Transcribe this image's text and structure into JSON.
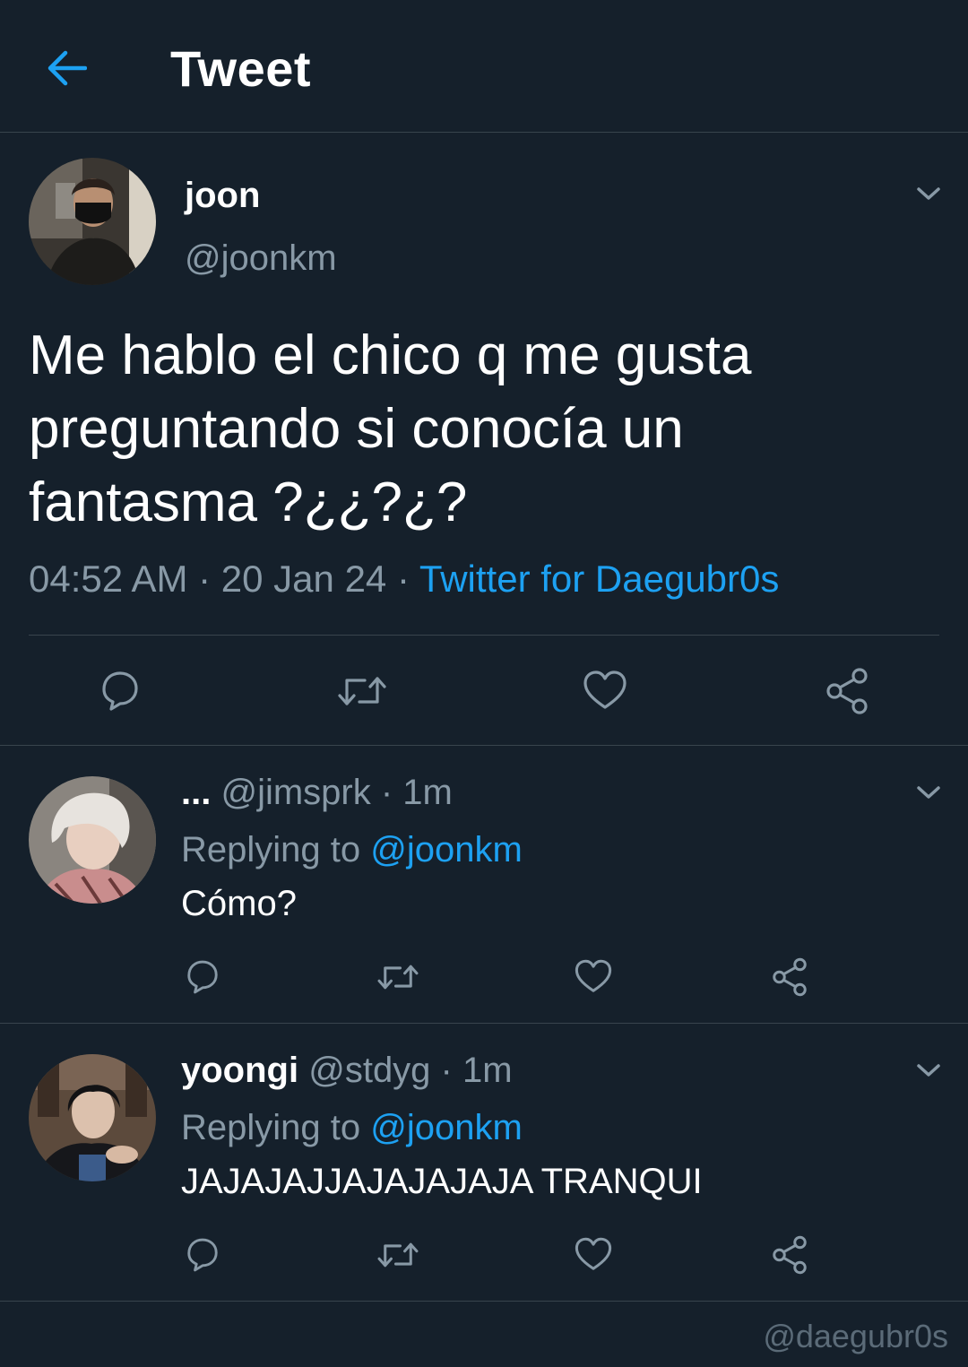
{
  "header": {
    "title": "Tweet",
    "back_icon": "arrow-left-icon",
    "accent": "#1da1f2"
  },
  "tweet": {
    "name": "joon",
    "handle": "@joonkm",
    "text": "Me hablo el chico q me gusta preguntando si conocía un fantasma ?¿¿?¿?",
    "time": "04:52 AM",
    "sep1": " · ",
    "date": "20 Jan 24",
    "sep2": " · ",
    "source": "Twitter for Daegubr0s"
  },
  "replies": [
    {
      "name": "...",
      "handle": "@jimsprk",
      "sep": " · ",
      "time": "1m",
      "replying_label": "Replying to ",
      "replying_to": "@joonkm",
      "text": "Cómo?"
    },
    {
      "name": "yoongi",
      "handle": "@stdyg",
      "sep": " · ",
      "time": "1m",
      "replying_label": "Replying to ",
      "replying_to": "@joonkm",
      "text": "JAJAJAJJAJAJAJAJA TRANQUI"
    }
  ],
  "watermark": "@daegubr0s",
  "colors": {
    "background": "#15202b",
    "border": "#38444d",
    "secondary_text": "#8899a6",
    "link": "#1da1f2"
  },
  "icons": [
    "reply-icon",
    "retweet-icon",
    "like-icon",
    "share-icon",
    "chevron-down-icon"
  ]
}
